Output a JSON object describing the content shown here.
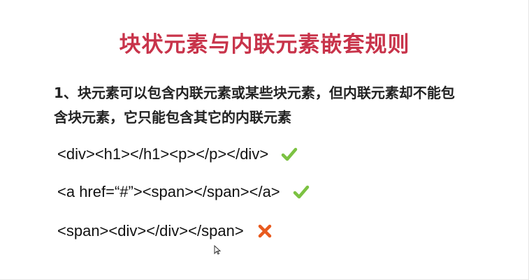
{
  "slide": {
    "title": "块状元素与内联元素嵌套规则",
    "rule_line1": "1、块元素可以包含内联元素或某些块元素，但内联元素却不能包",
    "rule_line2": "含块元素，它只能包含其它的内联元素",
    "examples": [
      {
        "code": "<div><h1></h1><p></p></div>",
        "status_icon": "check-icon",
        "valid": true
      },
      {
        "code": "<a href=“#”><span></span></a>",
        "status_icon": "check-icon",
        "valid": true
      },
      {
        "code": "<span><div></div></span>",
        "status_icon": "cross-icon",
        "valid": false
      }
    ]
  },
  "colors": {
    "title": "#c8334a",
    "check": "#7cc242",
    "cross": "#e85a1e",
    "text": "#111111"
  }
}
